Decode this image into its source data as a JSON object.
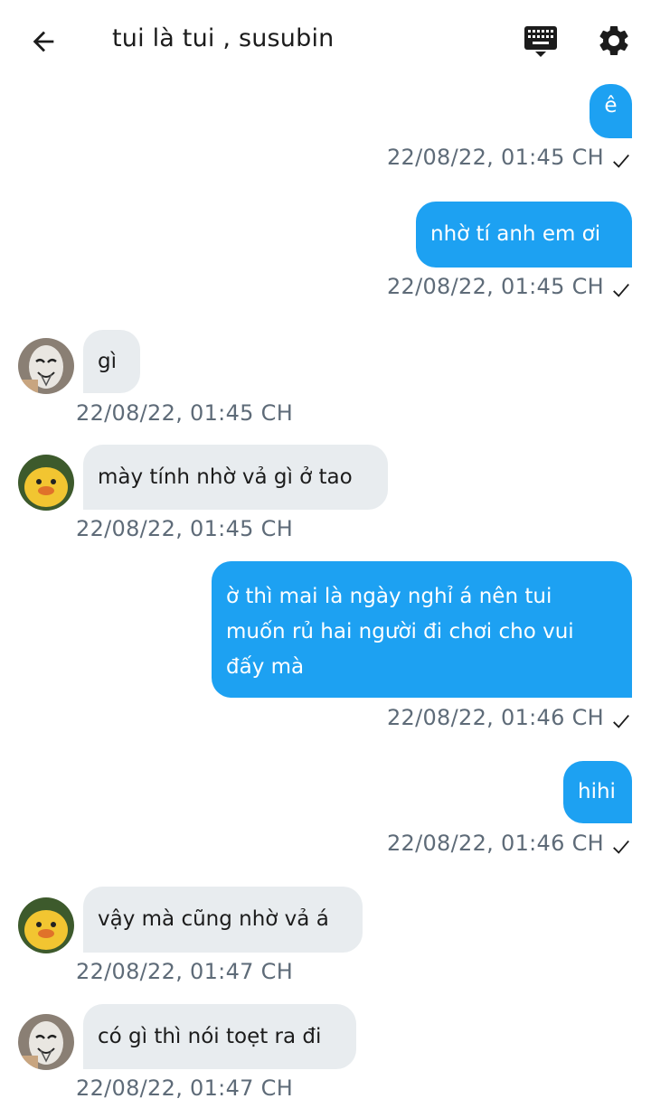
{
  "header": {
    "title": "tui là tui ,  susubin",
    "back_icon": "arrow-left-icon",
    "keyboard_icon": "keyboard-icon",
    "settings_icon": "gear-icon"
  },
  "colors": {
    "outgoing_bubble": "#1da1f2",
    "incoming_bubble": "#e8ecef",
    "timestamp": "#5e6b78"
  },
  "messages": [
    {
      "direction": "out",
      "text": "ê",
      "time": "22/08/22,  01:45 CH",
      "status": "sent-check"
    },
    {
      "direction": "out",
      "text": "nhờ tí anh em ơi",
      "time": "22/08/22,  01:45 CH",
      "status": "sent-check"
    },
    {
      "direction": "in",
      "avatar": "mask-avatar",
      "text": "gì",
      "time": "22/08/22,  01:45 CH"
    },
    {
      "direction": "in",
      "avatar": "duck-avatar",
      "text": "mày tính nhờ vả gì ở tao",
      "time": "22/08/22,  01:45 CH"
    },
    {
      "direction": "out",
      "lines": [
        "ờ thì mai là ngày nghỉ á nên tui",
        "muốn rủ hai người đi chơi cho vui",
        "đấy mà"
      ],
      "time": "22/08/22,  01:46 CH",
      "status": "sent-check"
    },
    {
      "direction": "out",
      "text": "hihi",
      "time": "22/08/22,  01:46 CH",
      "status": "sent-check"
    },
    {
      "direction": "in",
      "avatar": "duck-avatar",
      "text": "vậy mà cũng nhờ vả á",
      "time": "22/08/22,  01:47 CH"
    },
    {
      "direction": "in",
      "avatar": "mask-avatar",
      "text": "có gì thì nói toẹt ra đi",
      "time": "22/08/22,  01:47 CH"
    }
  ]
}
